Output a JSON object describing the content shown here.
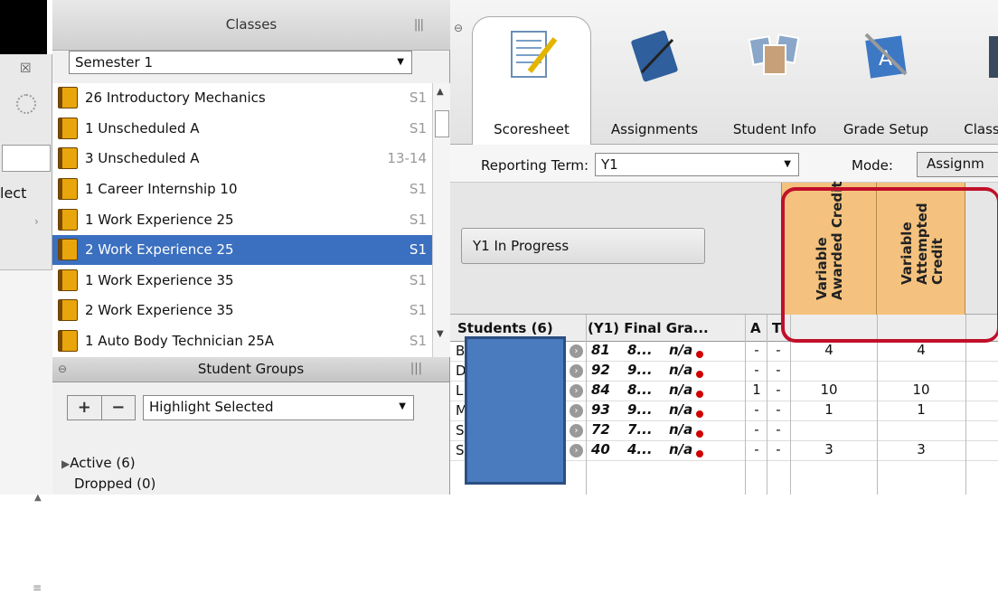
{
  "left_strip": {
    "partial_label": "lect"
  },
  "classes_panel": {
    "title": "Classes",
    "term_select": "Semester 1",
    "classes": [
      {
        "name": "26 Introductory Mechanics",
        "term": "S1"
      },
      {
        "name": "1 Unscheduled A",
        "term": "S1"
      },
      {
        "name": "3 Unscheduled A",
        "term": "13-14"
      },
      {
        "name": "1 Career Internship 10",
        "term": "S1"
      },
      {
        "name": "1 Work Experience 25",
        "term": "S1"
      },
      {
        "name": "2 Work Experience 25",
        "term": "S1",
        "selected": true
      },
      {
        "name": "1 Work Experience 35",
        "term": "S1"
      },
      {
        "name": "2 Work Experience 35",
        "term": "S1"
      },
      {
        "name": "1 Auto Body Technician 25A",
        "term": "S1"
      }
    ]
  },
  "groups_panel": {
    "title": "Student Groups",
    "plus": "+",
    "minus": "−",
    "highlight_select": "Highlight Selected",
    "tree": [
      "Active (6)",
      "Dropped (0)"
    ]
  },
  "tabs": {
    "scoresheet": "Scoresheet",
    "assignments": "Assignments",
    "student_info": "Student Info",
    "grade_setup": "Grade Setup",
    "class": "Class"
  },
  "reporting": {
    "label": "Reporting Term:",
    "value": "Y1",
    "mode_label": "Mode:",
    "mode_value": "Assignm"
  },
  "in_progress_button": "Y1 In Progress",
  "columns": {
    "students": "Students (6)",
    "final_grade": "(Y1) Final Gra...",
    "a": "A",
    "t": "T",
    "awarded_line1": "Variable",
    "awarded_line2": "Awarded Credit",
    "attempted_line1": "Variable",
    "attempted_line2": "Attempted",
    "attempted_line3": "Credit"
  },
  "students": [
    {
      "initial": "B",
      "grade": "81",
      "pct": "8...",
      "na": "n/a",
      "a": "-",
      "t": "-",
      "awarded": "4",
      "attempted": "4"
    },
    {
      "initial": "D",
      "grade": "92",
      "pct": "9...",
      "na": "n/a",
      "a": "-",
      "t": "-",
      "awarded": "",
      "attempted": ""
    },
    {
      "initial": "L",
      "grade": "84",
      "pct": "8...",
      "na": "n/a",
      "a": "1",
      "t": "-",
      "awarded": "10",
      "attempted": "10"
    },
    {
      "initial": "M",
      "grade": "93",
      "pct": "9...",
      "na": "n/a",
      "a": "-",
      "t": "-",
      "awarded": "1",
      "attempted": "1"
    },
    {
      "initial": "S",
      "grade": "72",
      "pct": "7...",
      "na": "n/a",
      "a": "-",
      "t": "-",
      "awarded": "",
      "attempted": ""
    },
    {
      "initial": "S",
      "grade": "40",
      "pct": "4...",
      "na": "n/a",
      "a": "-",
      "t": "-",
      "awarded": "3",
      "attempted": "3"
    }
  ],
  "colors": {
    "selected_row": "#3b6fbf",
    "credit_column": "#f4c27e",
    "highlight_box": "#c0102a",
    "redaction": "#4a7bbf"
  }
}
